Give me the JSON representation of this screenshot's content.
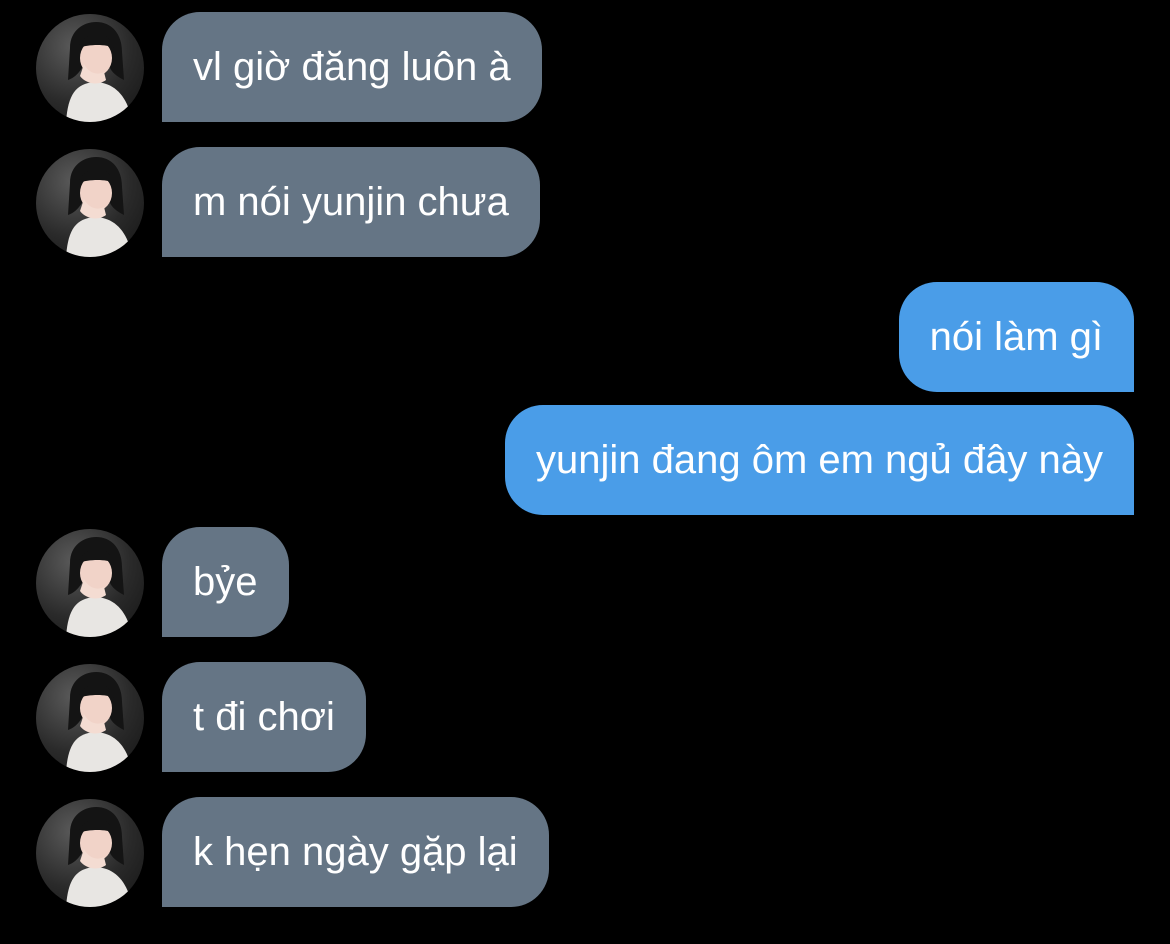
{
  "conversation": {
    "messages": [
      {
        "direction": "incoming",
        "text": "vl giờ đăng luôn à",
        "avatar_icon": "contact-avatar"
      },
      {
        "direction": "incoming",
        "text": "m nói yunjin chưa",
        "avatar_icon": "contact-avatar"
      },
      {
        "direction": "outgoing",
        "text": "nói làm gì"
      },
      {
        "direction": "outgoing",
        "text": "yunjin đang ôm em ngủ đây này"
      },
      {
        "direction": "incoming",
        "text": "bỷe",
        "avatar_icon": "contact-avatar"
      },
      {
        "direction": "incoming",
        "text": "t đi chơi",
        "avatar_icon": "contact-avatar"
      },
      {
        "direction": "incoming",
        "text": "k hẹn ngày gặp lại",
        "avatar_icon": "contact-avatar"
      }
    ]
  },
  "colors": {
    "background": "#000000",
    "incoming_bubble": "#657585",
    "outgoing_bubble": "#4a9de8",
    "text": "#ffffff"
  }
}
